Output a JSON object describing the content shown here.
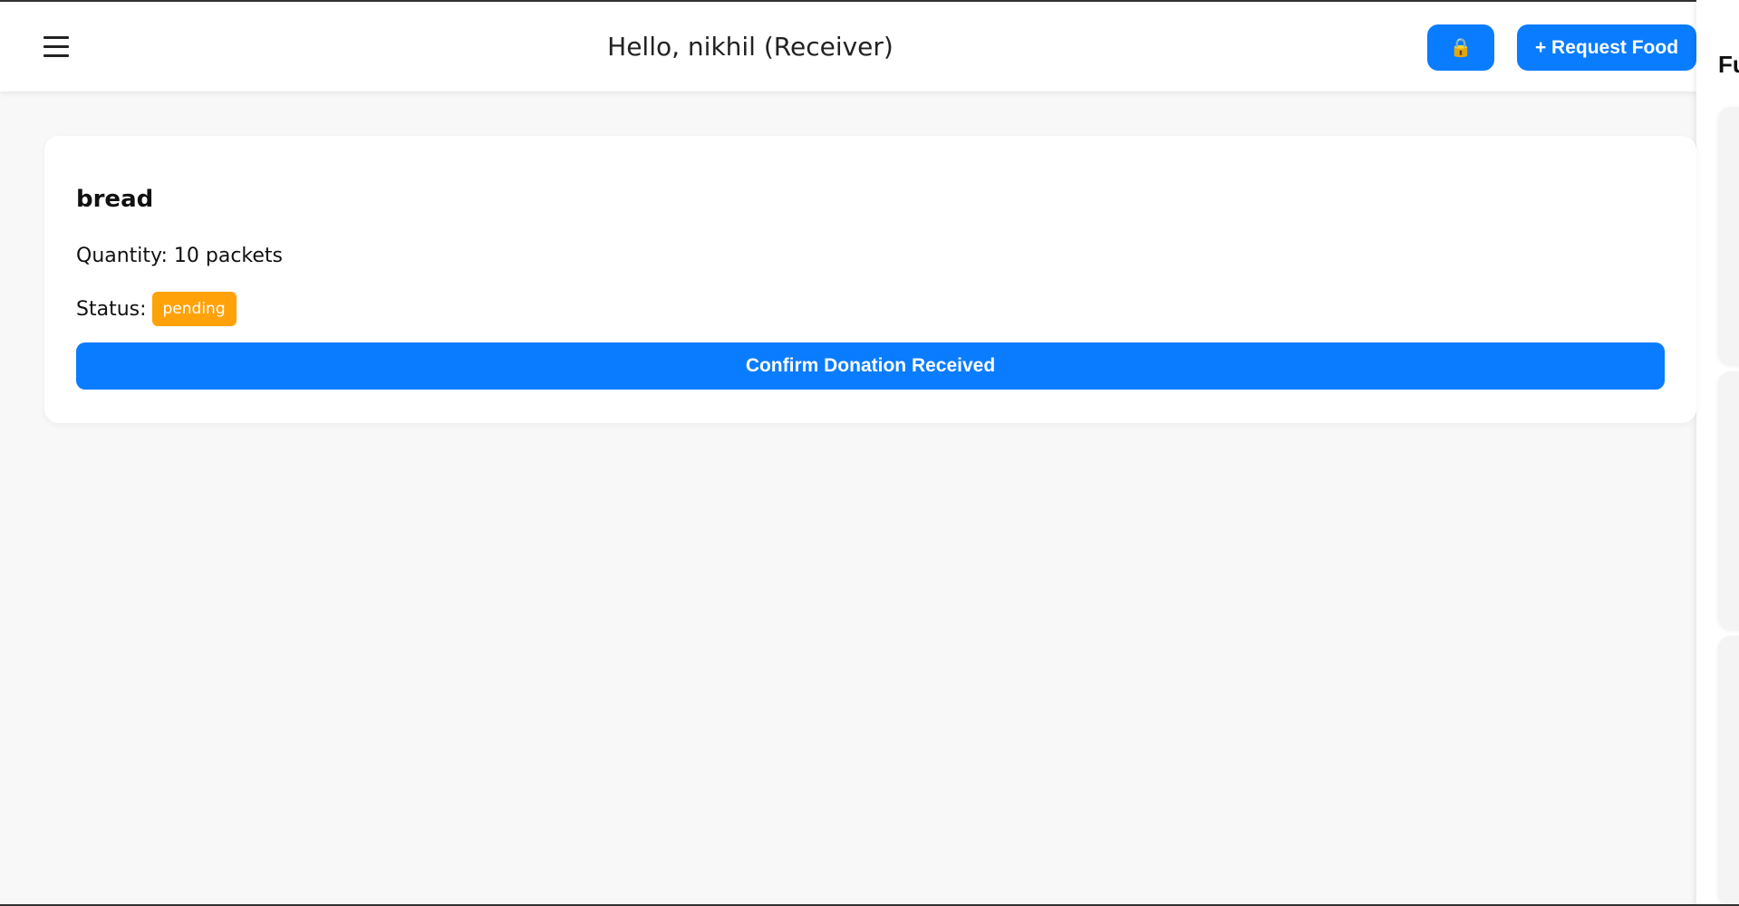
{
  "header": {
    "greeting": "Hello, nikhil (Receiver)",
    "lock_icon": "🔒",
    "request_button_label": "+ Request Food"
  },
  "side_panel": {
    "title_partial": "Fu"
  },
  "donation": {
    "name": "bread",
    "quantity_label": "Quantity:",
    "quantity_value": "10 packets",
    "status_label": "Status:",
    "status_value": "pending",
    "confirm_button_label": "Confirm Donation Received"
  },
  "colors": {
    "primary": "#0a7cff",
    "pending": "#ffa20a",
    "background": "#f8f8f8"
  },
  "icons": {
    "menu": "hamburger-menu-icon",
    "lock": "lock-icon"
  }
}
